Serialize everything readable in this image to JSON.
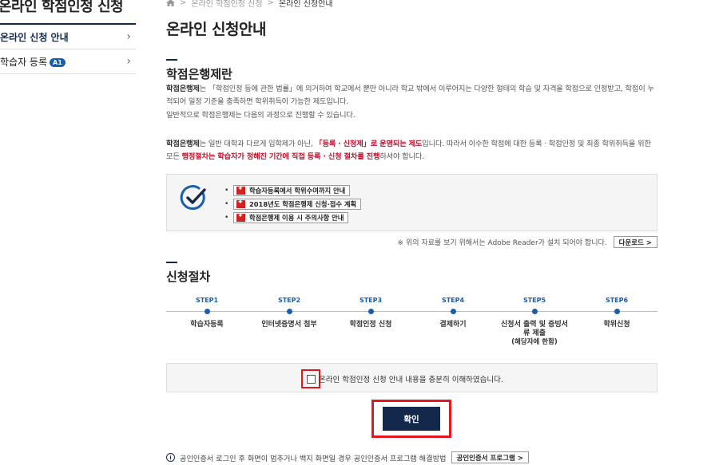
{
  "sidebar": {
    "title": "온라인 학점인정 신청",
    "items": [
      {
        "label": "온라인 신청 안내",
        "badge": ""
      },
      {
        "label": "학습자 등록",
        "badge": "A1"
      }
    ]
  },
  "breadcrumb": {
    "items": [
      "온라인 학점인정 신청",
      "온라인 신청안내"
    ]
  },
  "page_title": "온라인 신청안내",
  "section1": {
    "title": "학점은행제란",
    "p1_bold": "학점은행제",
    "p1_rest": "는 「학점인정 등에 관한 법률」에 의거하여 학교에서 뿐만 아니라 학교 밖에서 이루어지는 다양한 형태의 학습 및 자격을 학점으로 인정받고, 학점이 누적되어 일정 기준을 충족하면 학위취득이 가능한 제도입니다.",
    "p2": "일반적으로 학점은행제는 다음의 과정으로 진행할 수 있습니다.",
    "p3_bold": "학점은행제",
    "p3_a": "는 일반 대학과 다르게 입학제가 아닌, ",
    "p3_red1": "「등록 · 신청제」로 운영되는 제도",
    "p3_b": "입니다. 따라서 이수한 학점에 대한 등록 · 학점인정 및 최종 학위취득을 위한 모든 ",
    "p3_red2": "행정절차는 학습자가 정해진 기간에 직접 등록 · 신청 절차를 진행",
    "p3_c": "하셔야 합니다."
  },
  "documents": [
    {
      "label": "학습자등록에서 학위수여까지 안내",
      "icon": "pdf-icon"
    },
    {
      "label": "2018년도 학점은행제 신청·접수 계획",
      "icon": "pdf-icon"
    },
    {
      "label": "학점은행제 이용 시 주의사항 안내",
      "icon": "pdf-icon"
    }
  ],
  "adobe": {
    "note": "※ 위의 자료를 보기 위해서는 Adobe Reader가 설치 되어야 합니다.",
    "download_label": "다운로드 >"
  },
  "section2": {
    "title": "신청절차",
    "steps": [
      {
        "num": "STEP1",
        "label": "학습자등록",
        "sub": ""
      },
      {
        "num": "STEP2",
        "label": "인터넷증명서 첨부",
        "sub": ""
      },
      {
        "num": "STEP3",
        "label": "학점인정 신청",
        "sub": ""
      },
      {
        "num": "STEP4",
        "label": "결제하기",
        "sub": ""
      },
      {
        "num": "STEP5",
        "label": "신청서 출력 및 증빙서",
        "label2": "류 제출",
        "sub": "(해당자에 한함)"
      },
      {
        "num": "STEP6",
        "label": "학위신청",
        "sub": ""
      }
    ]
  },
  "agree": {
    "label": "온라인 학점인정 신청 안내 내용을 충분히 이해하였습니다.",
    "checked": false
  },
  "confirm_label": "확인",
  "footer": {
    "note": "공인인증서 로그인 후 화면이 멈추거나 백지 화면일 경우 공인인증서 프로그램 해결방법",
    "button_label": "공인인증서 프로그램 >"
  },
  "colors": {
    "navy": "#13294b",
    "accent_blue": "#1a5cae",
    "highlight_red": "#e0191f",
    "text_red": "#c8102e"
  }
}
